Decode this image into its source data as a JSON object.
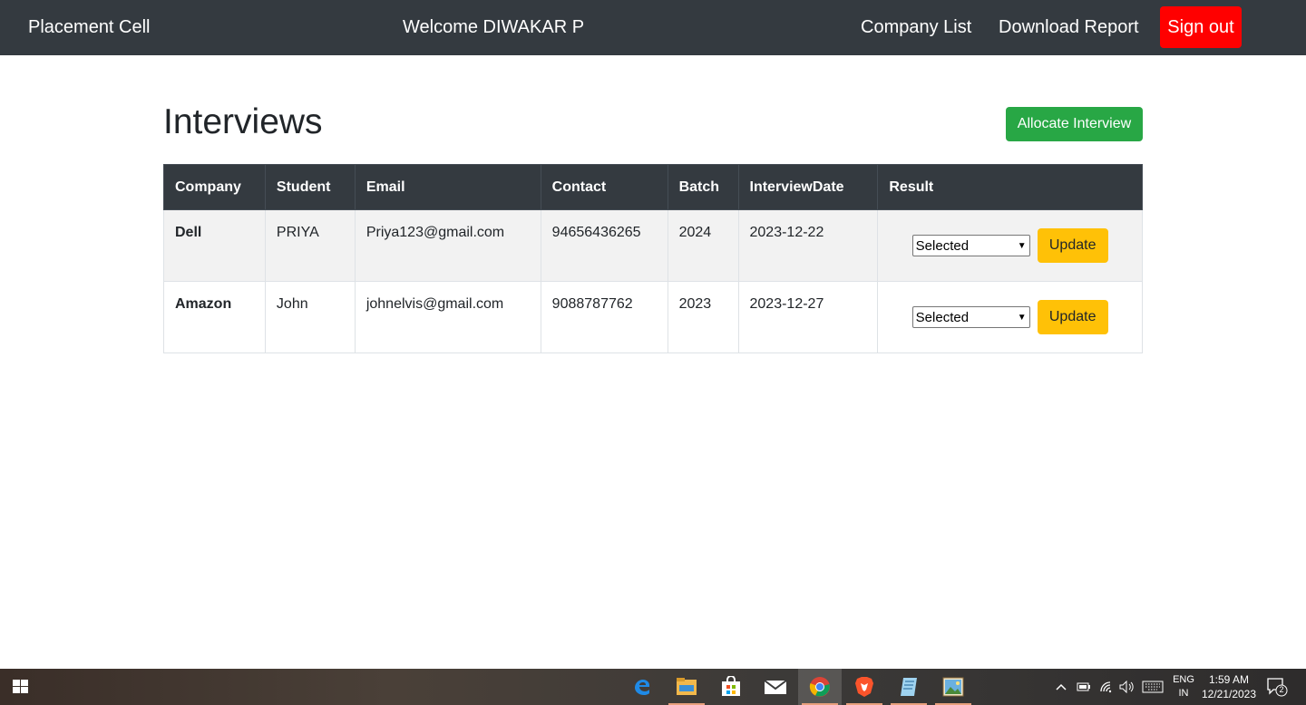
{
  "navbar": {
    "brand": "Placement Cell",
    "welcome": "Welcome DIWAKAR P",
    "links": [
      "Company List",
      "Download Report"
    ],
    "signout_label": "Sign out"
  },
  "page": {
    "title": "Interviews",
    "allocate_label": "Allocate Interview"
  },
  "table": {
    "headers": [
      "Company",
      "Student",
      "Email",
      "Contact",
      "Batch",
      "InterviewDate",
      "Result"
    ],
    "rows": [
      {
        "company": "Dell",
        "student": "PRIYA",
        "email": "Priya123@gmail.com",
        "contact": "94656436265",
        "batch": "2024",
        "date": "2023-12-22",
        "result": "Selected",
        "update_label": "Update"
      },
      {
        "company": "Amazon",
        "student": "John",
        "email": "johnelvis@gmail.com",
        "contact": "9088787762",
        "batch": "2023",
        "date": "2023-12-27",
        "result": "Selected",
        "update_label": "Update"
      }
    ]
  },
  "taskbar": {
    "apps": [
      "edge-icon",
      "file-explorer-icon",
      "store-icon",
      "mail-icon",
      "chrome-icon",
      "brave-icon",
      "notepad-icon",
      "photos-icon"
    ],
    "lang_top": "ENG",
    "lang_bottom": "IN",
    "time": "1:59 AM",
    "date": "12/21/2023",
    "notification_count": "2"
  },
  "colors": {
    "navbar": "#343a40",
    "signout": "#ff0000",
    "allocate": "#28a745",
    "update": "#ffc107"
  }
}
